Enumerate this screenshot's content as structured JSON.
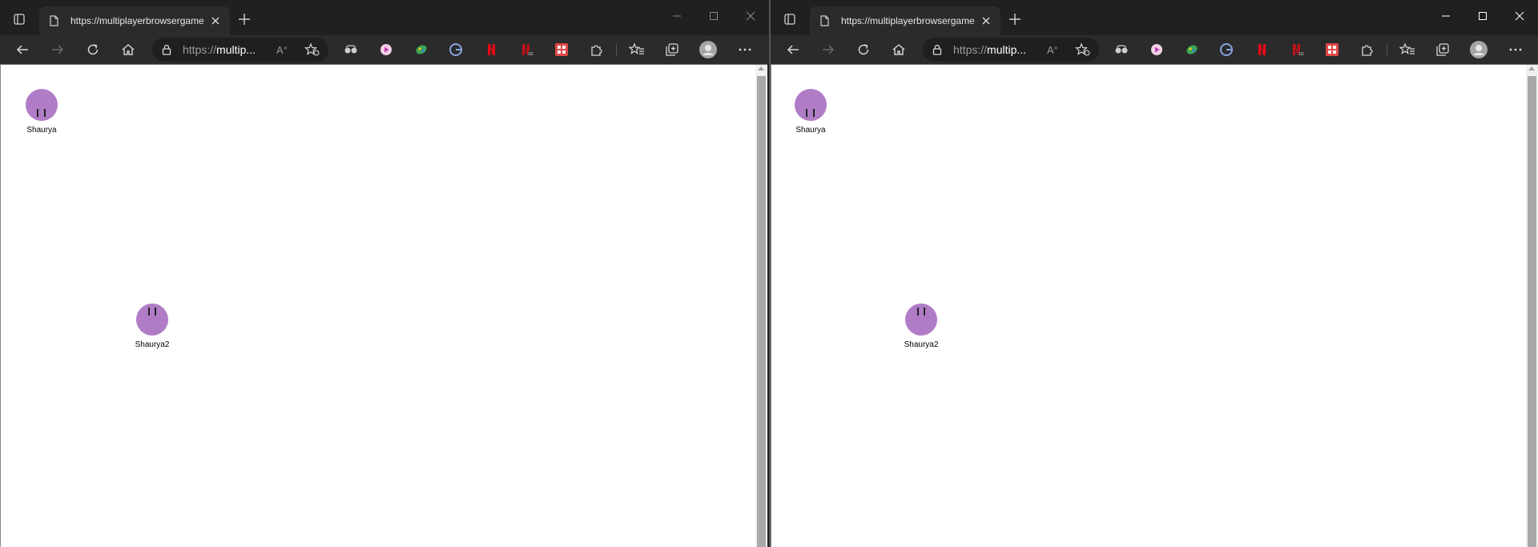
{
  "browser": {
    "tab_title": "https://multiplayerbrowsergame...",
    "address_prefix": "https://",
    "address_host": "multip...",
    "colors": {
      "titlebar": "#202020",
      "toolbar": "#2b2b2b",
      "page": "#ffffff",
      "player": "#b07cc6"
    }
  },
  "toolbar_icons": [
    "back-icon",
    "forward-icon",
    "refresh-icon",
    "home-icon",
    "read-aloud-icon",
    "add-favorite-icon",
    "extension-icons",
    "extensions-icon",
    "favorites-icon",
    "collections-icon",
    "profile-avatar-icon",
    "more-icon"
  ],
  "game": {
    "players": [
      {
        "name": "Shaurya",
        "eyes": "down"
      },
      {
        "name": "Shaurya2",
        "eyes": "up"
      }
    ]
  }
}
